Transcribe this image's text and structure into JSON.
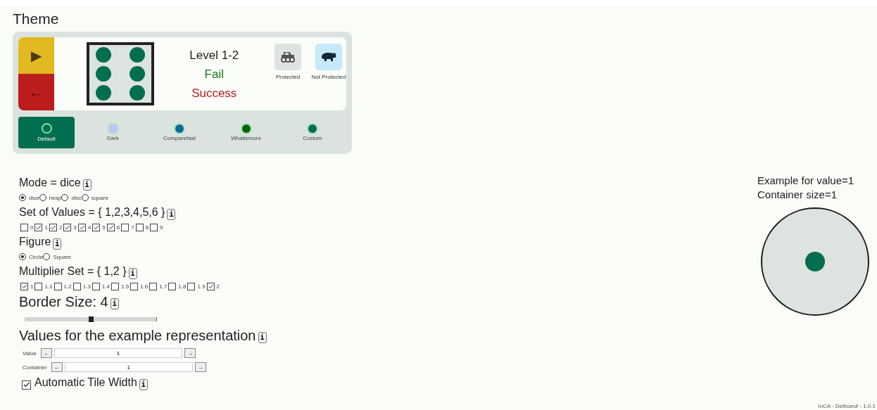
{
  "theme": {
    "title": "Theme",
    "preview": {
      "play": "▶",
      "back": "←",
      "level": "Level 1-2",
      "fail": "Fail",
      "success": "Success",
      "badges": [
        {
          "label": "Protected",
          "kind": "truck",
          "color": "#dfe3df"
        },
        {
          "label": "Not Protected",
          "kind": "animal",
          "color": "#c8e8fb"
        }
      ]
    },
    "options": [
      {
        "label": "Default",
        "selected": true,
        "color": "#7de0b8"
      },
      {
        "label": "Dark",
        "selected": false,
        "color": "#c0c4ff"
      },
      {
        "label": "Comparefast",
        "selected": false,
        "color": "#0a6a9a"
      },
      {
        "label": "Whatismore",
        "selected": false,
        "color": "#006400"
      },
      {
        "label": "Custom",
        "selected": false,
        "color": "#006e4f"
      }
    ]
  },
  "settings": [
    {
      "kind": "heading",
      "text": "Mode = dice",
      "info": "i"
    },
    {
      "kind": "radio",
      "options": [
        {
          "label": "dice",
          "selected": true
        },
        {
          "label": "heap",
          "selected": false
        },
        {
          "label": "disc",
          "selected": false
        },
        {
          "label": "square",
          "selected": false
        }
      ]
    },
    {
      "kind": "heading",
      "text": "Set of Values = { 1,2,3,4,5,6 }",
      "info": "i"
    },
    {
      "kind": "checks",
      "options": [
        {
          "label": "0",
          "checked": false
        },
        {
          "label": "1",
          "checked": true
        },
        {
          "label": "2",
          "checked": true
        },
        {
          "label": "3",
          "checked": true
        },
        {
          "label": "4",
          "checked": true
        },
        {
          "label": "5",
          "checked": true
        },
        {
          "label": "6",
          "checked": true
        },
        {
          "label": "7",
          "checked": false
        },
        {
          "label": "8",
          "checked": false
        },
        {
          "label": "9",
          "checked": false
        }
      ]
    },
    {
      "kind": "heading",
      "text": "Figure",
      "info": "i"
    },
    {
      "kind": "radio",
      "options": [
        {
          "label": "Circle",
          "selected": true
        },
        {
          "label": "Square",
          "selected": false
        }
      ]
    },
    {
      "kind": "heading",
      "text": "Multiplier Set = { 1,2 }",
      "info": "i"
    },
    {
      "kind": "checks",
      "options": [
        {
          "label": "1",
          "checked": true
        },
        {
          "label": "1.1",
          "checked": false
        },
        {
          "label": "1.2",
          "checked": false
        },
        {
          "label": "1.3",
          "checked": false
        },
        {
          "label": "1.4",
          "checked": false
        },
        {
          "label": "1.5",
          "checked": false
        },
        {
          "label": "1.6",
          "checked": false
        },
        {
          "label": "1.7",
          "checked": false
        },
        {
          "label": "1.8",
          "checked": false
        },
        {
          "label": "1.9",
          "checked": false
        },
        {
          "label": "2",
          "checked": true
        }
      ]
    },
    {
      "kind": "title",
      "text": "Border Size: 4",
      "info": "i"
    },
    {
      "kind": "slider",
      "level": 0.5
    },
    {
      "kind": "title",
      "text": "Values for the example representation",
      "info": "i"
    },
    {
      "kind": "stepper",
      "label": "Value",
      "prev": "←",
      "value": "1",
      "next": "→"
    },
    {
      "kind": "stepper",
      "label": "Container",
      "prev": "←",
      "value": "1",
      "next": "→"
    },
    {
      "kind": "check-heading",
      "text": "Automatic Tile Width",
      "checked": true,
      "info": "i"
    }
  ],
  "example": {
    "lines": [
      "Example for value=1",
      "Container size=1"
    ]
  },
  "footer": "InCA - Delboeuf - 1.0.1"
}
